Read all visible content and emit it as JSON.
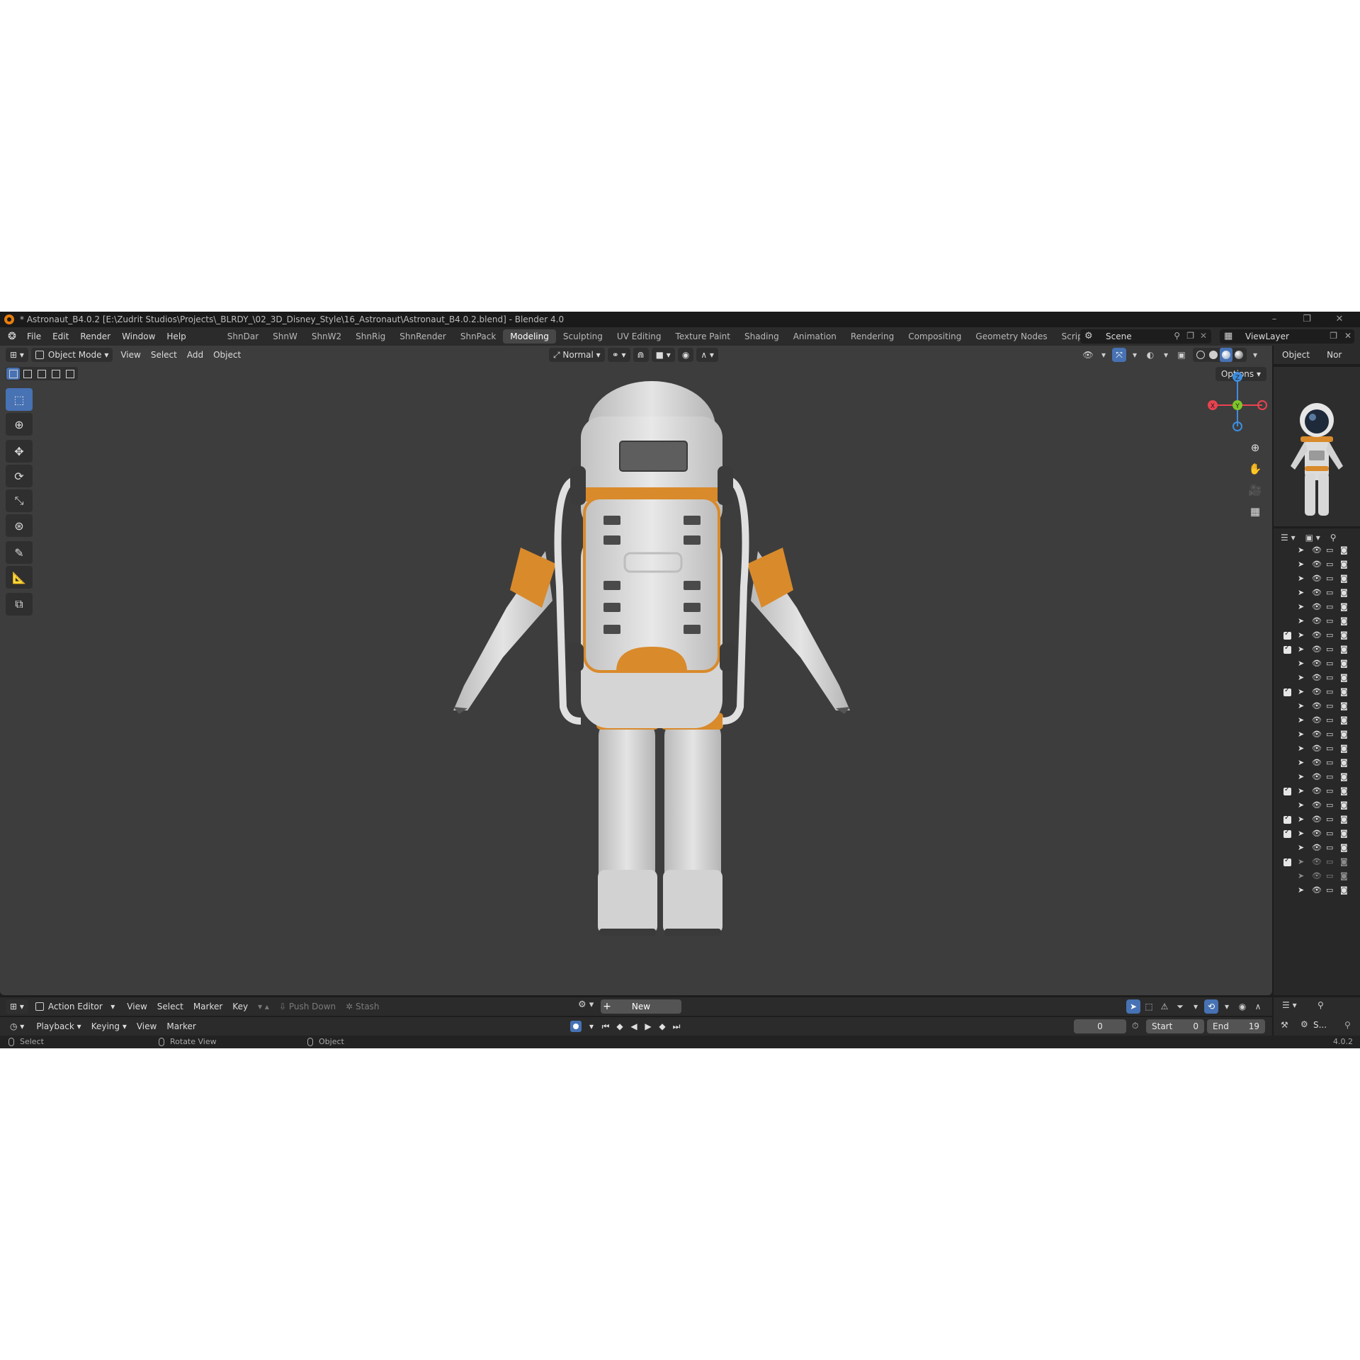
{
  "window": {
    "title": "* Astronaut_B4.0.2 [E:\\Zudrit Studios\\Projects\\_BLRDY_\\02_3D_Disney_Style\\16_Astronaut\\Astronaut_B4.0.2.blend] - Blender 4.0",
    "minimize": "–",
    "maximize": "❐",
    "close": "✕"
  },
  "menu": [
    "File",
    "Edit",
    "Render",
    "Window",
    "Help"
  ],
  "workspace_tabs": [
    {
      "label": "ShnDar",
      "active": false
    },
    {
      "label": "ShnW",
      "active": false
    },
    {
      "label": "ShnW2",
      "active": false
    },
    {
      "label": "ShnRig",
      "active": false
    },
    {
      "label": "ShnRender",
      "active": false
    },
    {
      "label": "ShnPack",
      "active": false
    },
    {
      "label": "Modeling",
      "active": true
    },
    {
      "label": "Sculpting",
      "active": false
    },
    {
      "label": "UV Editing",
      "active": false
    },
    {
      "label": "Texture Paint",
      "active": false
    },
    {
      "label": "Shading",
      "active": false
    },
    {
      "label": "Animation",
      "active": false
    },
    {
      "label": "Rendering",
      "active": false
    },
    {
      "label": "Compositing",
      "active": false
    },
    {
      "label": "Geometry Nodes",
      "active": false
    },
    {
      "label": "Scripting",
      "active": false
    }
  ],
  "add_tab": "+",
  "scene": {
    "label": "Scene"
  },
  "view_layer": {
    "label": "ViewLayer"
  },
  "viewport": {
    "mode": "Object Mode",
    "menus": [
      "View",
      "Select",
      "Add",
      "Object"
    ],
    "orientation": "Normal",
    "options": "Options",
    "gizmo": {
      "x": "X",
      "y": "Y",
      "z": "Z",
      "x_color": "#e8434f",
      "y_color": "#7ec629",
      "z_color": "#3d8ee0"
    }
  },
  "properties": {
    "tab_object": "Object",
    "tab_other": "Nor"
  },
  "outliner_rows": [
    {
      "checked": false,
      "dim": false
    },
    {
      "checked": false,
      "dim": false
    },
    {
      "checked": false,
      "dim": false
    },
    {
      "checked": false,
      "dim": false
    },
    {
      "checked": false,
      "dim": false
    },
    {
      "checked": false,
      "dim": false
    },
    {
      "checked": true,
      "dim": false
    },
    {
      "checked": true,
      "dim": false
    },
    {
      "checked": false,
      "dim": false
    },
    {
      "checked": false,
      "dim": false
    },
    {
      "checked": true,
      "dim": false
    },
    {
      "checked": false,
      "dim": false
    },
    {
      "checked": false,
      "dim": false
    },
    {
      "checked": false,
      "dim": false
    },
    {
      "checked": false,
      "dim": false
    },
    {
      "checked": false,
      "dim": false
    },
    {
      "checked": false,
      "dim": false
    },
    {
      "checked": true,
      "dim": false
    },
    {
      "checked": false,
      "dim": false
    },
    {
      "checked": true,
      "dim": false
    },
    {
      "checked": true,
      "dim": false
    },
    {
      "checked": false,
      "dim": false
    },
    {
      "checked": true,
      "dim": true
    },
    {
      "checked": false,
      "dim": true
    },
    {
      "checked": false,
      "dim": false
    }
  ],
  "action_editor": {
    "mode": "Action Editor",
    "menus": [
      "View",
      "Select",
      "Marker",
      "Key"
    ],
    "push_down": "Push Down",
    "stash": "Stash",
    "new": "New"
  },
  "timeline": {
    "menus": [
      "Playback",
      "Keying",
      "View",
      "Marker"
    ],
    "current_frame": "0",
    "start_label": "Start",
    "start": "0",
    "end_label": "End",
    "end": "19",
    "scene_short": "S..."
  },
  "status": {
    "select": "Select",
    "rotate": "Rotate View",
    "object": "Object",
    "version": "4.0.2"
  },
  "colors": {
    "accent": "#4772b3",
    "suit_orange": "#d98a2b",
    "viewport_bg": "#3d3d3d"
  }
}
